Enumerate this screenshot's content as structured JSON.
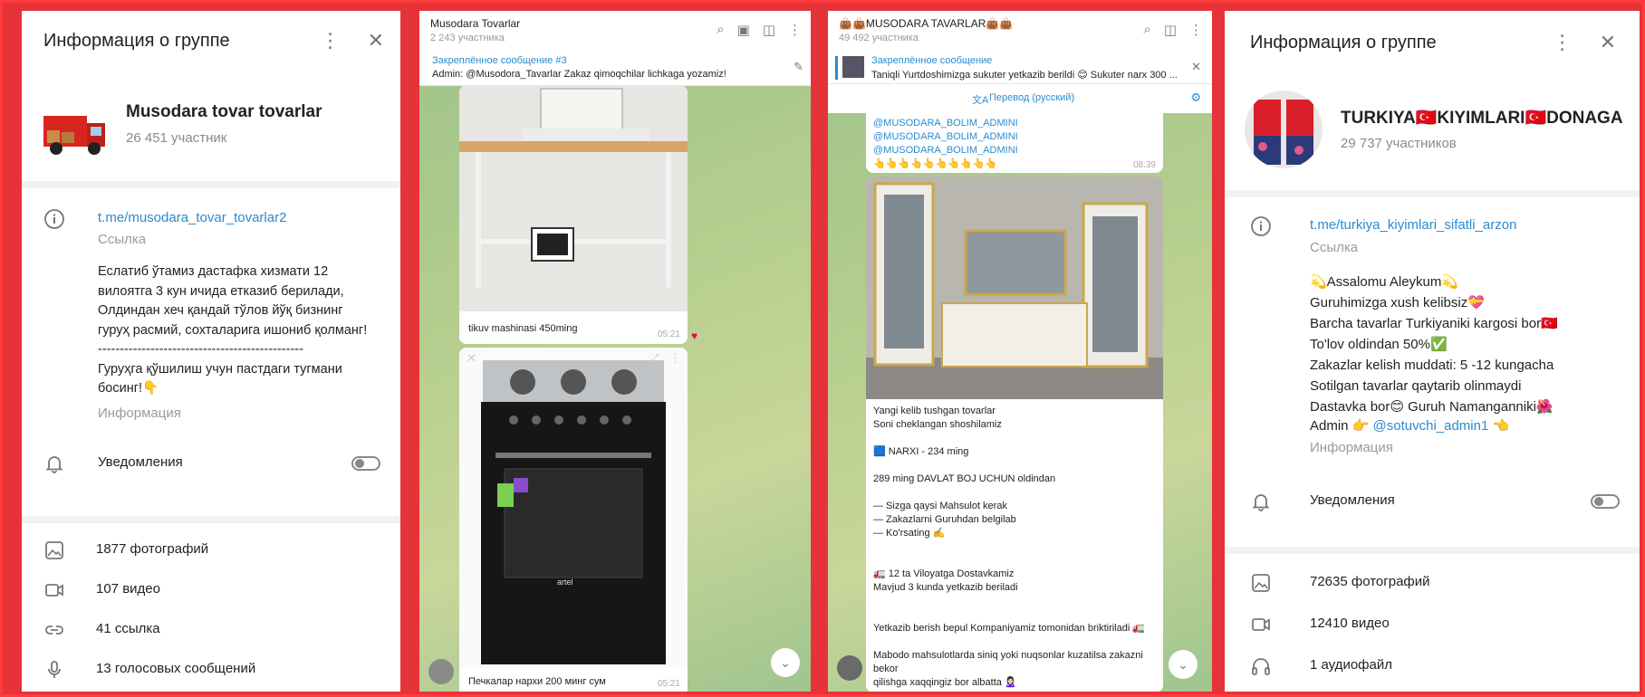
{
  "left_info": {
    "title": "Информация о группе",
    "group_name": "Musodara tovar tovarlar",
    "members": "26 451 участник",
    "link": "t.me/musodara_tovar_tovarlar2",
    "link_label": "Ссылка",
    "description": "Еслатиб ўтамиз дастафка хизмати 12\nвилоятга 3 кун ичида етказиб берилади,\nОлдиндан хеч қандай тўлов йўқ бизнинг\nгуруҳ расмий, сохталарига ишониб қолманг!\n-----------------------------------------------\nГуруҳга қўшилиш учун пастдаги тугмани\nбосинг!👇",
    "description_label": "Информация",
    "notifications": "Уведомления",
    "media": [
      {
        "icon": "photo-icon",
        "label": "1877 фотографий"
      },
      {
        "icon": "video-icon",
        "label": "107 видео"
      },
      {
        "icon": "link-icon",
        "label": "41 ссылка"
      },
      {
        "icon": "mic-icon",
        "label": "13 голосовых сообщений"
      }
    ]
  },
  "chat1": {
    "title": "Musodara Tovarlar",
    "subtitle": "2 243 участника",
    "pinned_title": "Закреплённое сообщение #3",
    "pinned_text": "Admin: @Musodora_Tavarlar  Zakaz qimoqchilar lichkaga yozamiz!",
    "msg1_text": "tikuv mashinasi 450ming",
    "msg1_time": "05:21",
    "msg2_text": "Печкалар нархи 200 минг сум",
    "msg2_time": "05:21",
    "stove_brand": "artel"
  },
  "chat2": {
    "title": "👜👜MUSODARA TAVARLAR👜👜",
    "subtitle": "49 492 участника",
    "pinned_title": "Закреплённое сообщение",
    "pinned_text": "Taniqli Yurtdoshimizga sukuter  yetkazib berildi 😊  Sukuter narx 300 ...",
    "translate": "Перевод (русский)",
    "prev_text": "@MUSODARA_BOLIM_ADMINI\n@MUSODARA_BOLIM_ADMINI\n@MUSODARA_BOLIM_ADMINI\n👆👆👆👆👆👆👆👆👆👆",
    "prev_time": "08:39",
    "msg_text": "Yangi kelib tushgan tovarlar\nSoni cheklangan shoshilamiz\n\n🟦 NARXI - 234 ming\n\n289 ming DAVLAT BOJ UCHUN  oldindan\n\n—  Sizga qaysi Mahsulot kerak\n—  Zakazlarni Guruhdan belgilab\n—  Ko'rsating  ✍️\n\n\n🚛 12 ta Viloyatga Dostavkamiz\nMavjud 3 kunda yetkazib beriladi\n\n\nYetkazib berish bepul Kompaniyamiz tomonidan briktiriladi 🚛\n\nMabodo mahsulotlarda siniq yoki nuqsonlar kuzatilsa zakazni bekor\nqilishga xaqqingiz bor albatta 🙎🏻‍♀️"
  },
  "right_info": {
    "title": "Информация о группе",
    "group_name": "TURKIYA🇹🇷KIYIMLARI🇹🇷DONAGA",
    "members": "29 737 участников",
    "link": "t.me/turkiya_kiyimlari_sifatli_arzon",
    "link_label": "Ссылка",
    "description": "💫Assalomu Aleykum💫\nGuruhimizga xush kelibsiz💝\nBarcha tavarlar Turkiyaniki kargosi bor🇹🇷\nTo'lov oldindan 50%✅\nZakazlar kelish muddati: 5 -12 kungacha\nSotilgan tavarlar qaytarib olinmaydi\nDastavka bor😊 Guruh Namanganniki🌺",
    "admin_prefix": "Admin 👉 ",
    "admin_handle": "@sotuvchi_admin1",
    "admin_suffix": " 👈",
    "description_label": "Информация",
    "notifications": "Уведомления",
    "media": [
      {
        "icon": "photo-icon",
        "label": "72635 фотографий"
      },
      {
        "icon": "video-icon",
        "label": "12410 видео"
      },
      {
        "icon": "headphones-icon",
        "label": "1 аудиофайл"
      }
    ]
  }
}
